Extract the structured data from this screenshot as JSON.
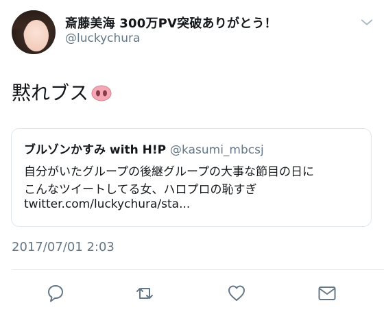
{
  "user": {
    "display_name": "斎藤美海 300万PV突破ありがとう！",
    "handle": "@luckychura",
    "avatar_icon": "profile-photo"
  },
  "tweet": {
    "text": "黙れブス",
    "emoji_icon": "pig-nose-icon"
  },
  "quote": {
    "name": "ブルゾンかすみ with H!P",
    "handle": "@kasumi_mbcsj",
    "lines": [
      "自分がいたグループの後継グループの大事な節目の日に",
      "こんなツイートしてる女、ハロプロの恥すぎ",
      "twitter.com/luckychura/sta..."
    ]
  },
  "timestamp": "2017/07/01 2:03",
  "actions": [
    "reply-icon",
    "retweet-icon",
    "like-icon",
    "message-icon"
  ],
  "colors": {
    "text": "#14171a",
    "secondary": "#657786",
    "border": "#e1e8ed",
    "pig": "#f4a7b4"
  }
}
